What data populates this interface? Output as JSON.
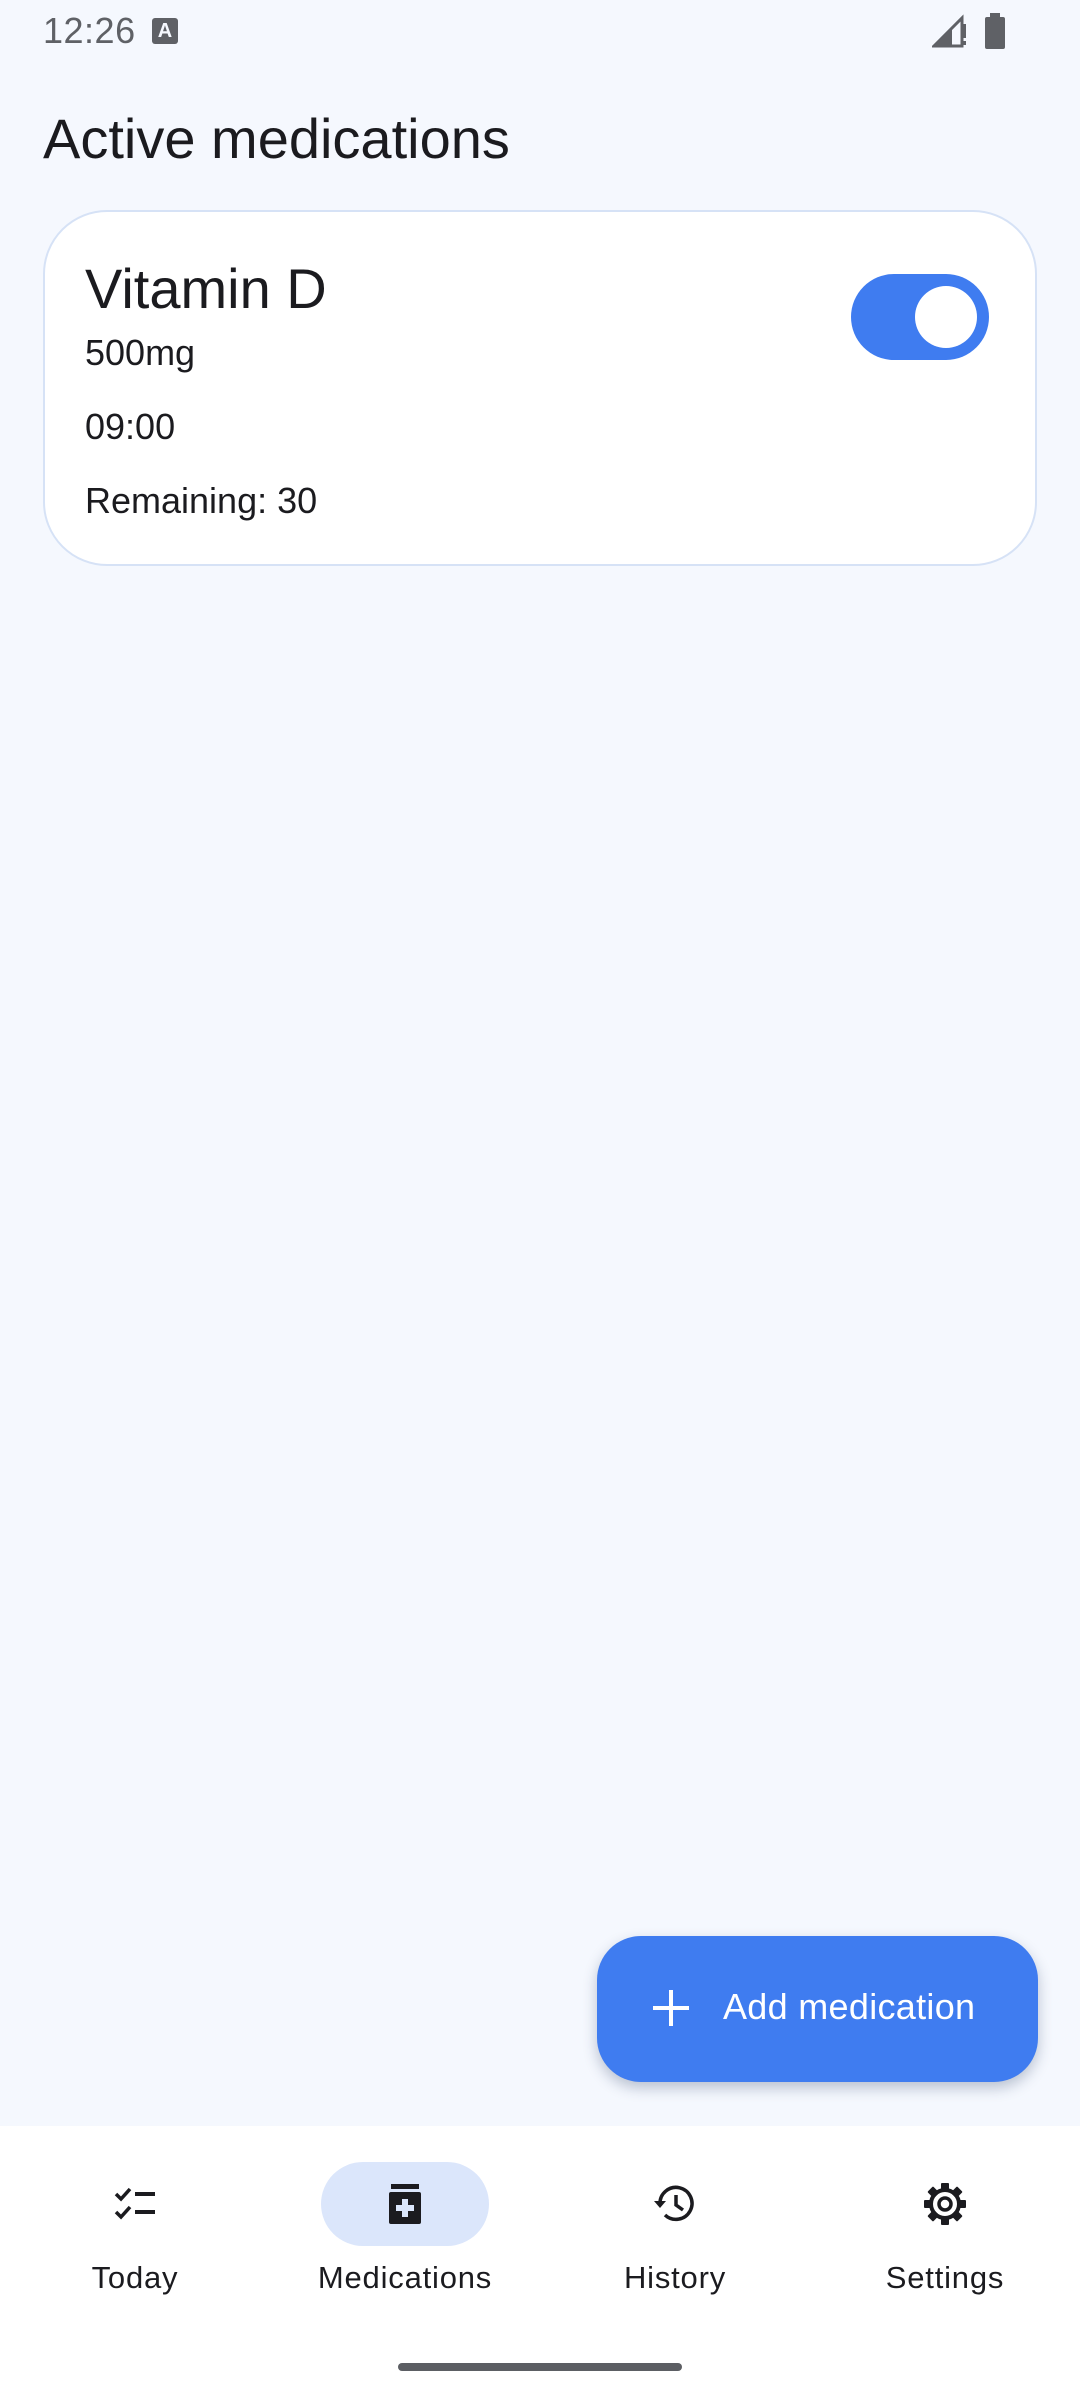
{
  "status_bar": {
    "time": "12:26",
    "notification_icon": "a-icon",
    "signal_icon": "signal-icon",
    "battery_icon": "battery-icon"
  },
  "page": {
    "title": "Active medications"
  },
  "medications": [
    {
      "name": "Vitamin D",
      "dose": "500mg",
      "time": "09:00",
      "remaining": "Remaining: 30",
      "enabled": true
    }
  ],
  "fab": {
    "label": "Add medication",
    "icon": "plus-icon"
  },
  "bottom_nav": {
    "items": [
      {
        "label": "Today",
        "icon": "checklist-icon",
        "active": false
      },
      {
        "label": "Medications",
        "icon": "medication-icon",
        "active": true
      },
      {
        "label": "History",
        "icon": "history-icon",
        "active": false
      },
      {
        "label": "Settings",
        "icon": "gear-icon",
        "active": false
      }
    ]
  },
  "colors": {
    "background": "#f5f8fe",
    "accent": "#3f7cf0",
    "active_indicator": "#dbe6fb",
    "card_border": "#d6e2f6"
  }
}
